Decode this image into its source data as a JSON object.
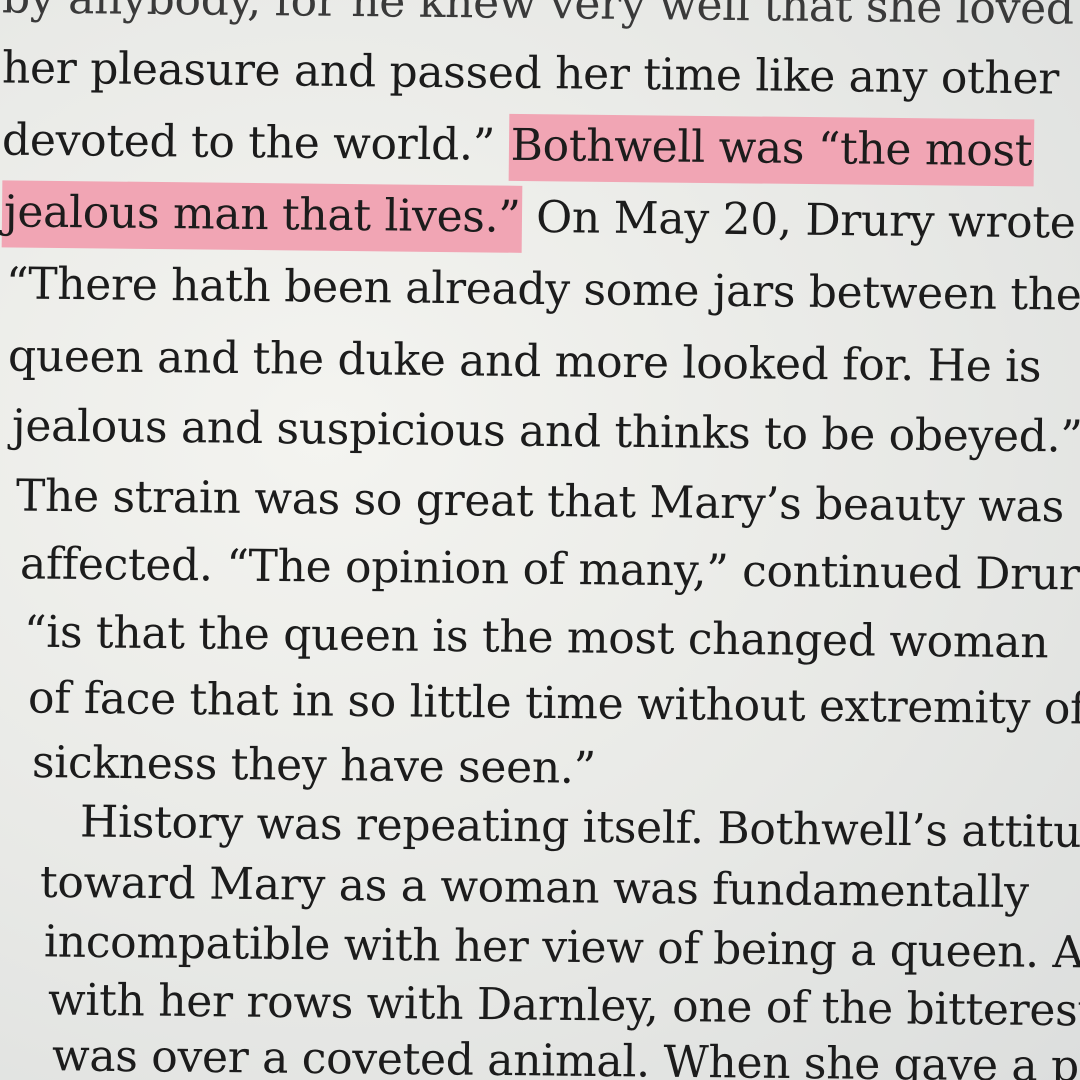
{
  "book_page": {
    "lines": [
      "by anybody, for he knew very well that she loved",
      "her pleasure and passed her time like any other",
      "devoted to the world.”",
      "Bothwell was “the most",
      "jealous man that lives.”",
      "On May 20, Drury wrote",
      "“There hath been already some jars between the",
      "queen and the duke and more looked for. He is",
      "jealous and suspicious and thinks to be obeyed.”",
      "The strain was so great that Mary’s beauty was",
      "affected. “The opinion of many,” continued Drury",
      "“is that the queen is the most changed woman",
      "of face that in so little time without extremity of",
      "sickness they have seen.”",
      "History was repeating itself. Bothwell’s attitude",
      "toward Mary as a woman was fundamentally",
      "incompatible with her view of being a queen. As",
      "with her rows with Darnley, one of the bitterest",
      "was over a coveted animal. When she gave a par-"
    ],
    "highlight_color": "#f1a5b4"
  }
}
